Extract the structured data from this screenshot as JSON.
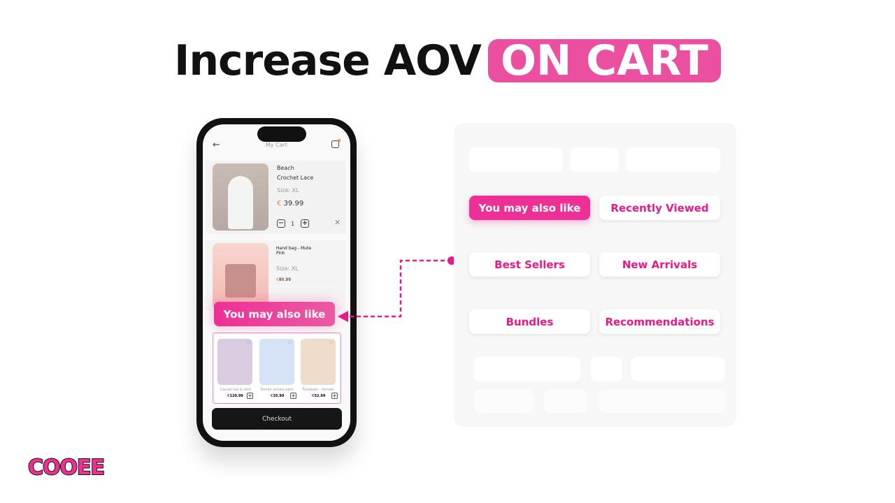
{
  "headline": {
    "main": "Increase AOV",
    "highlight": "ON CART"
  },
  "colors": {
    "accent": "#ea4fa0",
    "button_text": "#e8198b"
  },
  "phone": {
    "header": {
      "title": "My Cart",
      "back_icon": "arrow-left-icon",
      "cart_icon": "shopping-bag-icon"
    },
    "cart_items": [
      {
        "name_line1": "Beach",
        "name_line2": "Crochet Lace",
        "size": "Size: XL",
        "currency": "€",
        "price": "39.99",
        "qty": "1"
      },
      {
        "name_line1": "Hand bag - Mute",
        "name_line2": "Pink",
        "size": "Size: XL",
        "currency": "€",
        "price": "80.99"
      }
    ],
    "overlay_label": "You may also like",
    "recommendations": [
      {
        "name": "Casual top & skirt",
        "currency": "€",
        "price": "120.99"
      },
      {
        "name": "Denim unisex pant",
        "currency": "€",
        "price": "35.99"
      },
      {
        "name": "Footwear - female",
        "currency": "€",
        "price": "52.99"
      }
    ],
    "checkout_label": "Checkout"
  },
  "options": [
    {
      "label": "You may also like",
      "active": true
    },
    {
      "label": "Recently Viewed",
      "active": false
    },
    {
      "label": "Best Sellers",
      "active": false
    },
    {
      "label": "New Arrivals",
      "active": false
    },
    {
      "label": "Bundles",
      "active": false
    },
    {
      "label": "Recommendations",
      "active": false
    }
  ],
  "logo": {
    "text": "COOEE"
  }
}
